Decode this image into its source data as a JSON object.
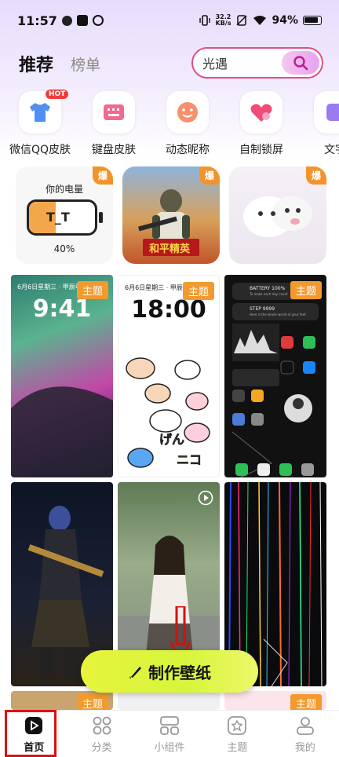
{
  "status": {
    "time": "11:57",
    "net_speed_top": "32.2",
    "net_speed_unit": "KB/s",
    "battery": "94%"
  },
  "header": {
    "tab_active": "推荐",
    "tab_2": "榜单",
    "search_text": "光遇"
  },
  "categories": [
    {
      "label": "微信QQ皮肤",
      "badge": "HOT",
      "icon": "shirt-icon"
    },
    {
      "label": "键盘皮肤",
      "icon": "keyboard-icon"
    },
    {
      "label": "动态昵称",
      "icon": "smiley-icon"
    },
    {
      "label": "自制锁屏",
      "icon": "heart-lock-icon"
    },
    {
      "label": "文字",
      "icon": "text-icon"
    }
  ],
  "widgets": {
    "badge": "爆",
    "electricity": {
      "title": "你的电量",
      "face": "T_T",
      "percent": "40%"
    },
    "game_card": {
      "text": "和平精英"
    }
  },
  "wallpapers": {
    "theme_badge": "主题",
    "lock1": {
      "date": "6月6日星期三 · 甲辰年",
      "time": "9:41"
    },
    "lock2": {
      "date": "6月6日星期三 · 甲辰年七月",
      "time": "18:00"
    },
    "widget_phone": {
      "battery": "BATTERY 100%",
      "battery_sub": "To make each day count",
      "step": "STEP 9999",
      "step_sub": "Here is the whole world of your feet"
    }
  },
  "make_button": {
    "label": "制作壁纸"
  },
  "nav": {
    "items": [
      {
        "label": "首页",
        "icon": "play-icon"
      },
      {
        "label": "分类",
        "icon": "grid-icon"
      },
      {
        "label": "小组件",
        "icon": "widget-icon"
      },
      {
        "label": "主题",
        "icon": "star-icon"
      },
      {
        "label": "我的",
        "icon": "user-icon"
      }
    ]
  },
  "colors": {
    "accent": "#e04e86",
    "theme_badge": "#f29a2e",
    "make_button": "#e2f53d",
    "highlight_red": "#d11111"
  }
}
